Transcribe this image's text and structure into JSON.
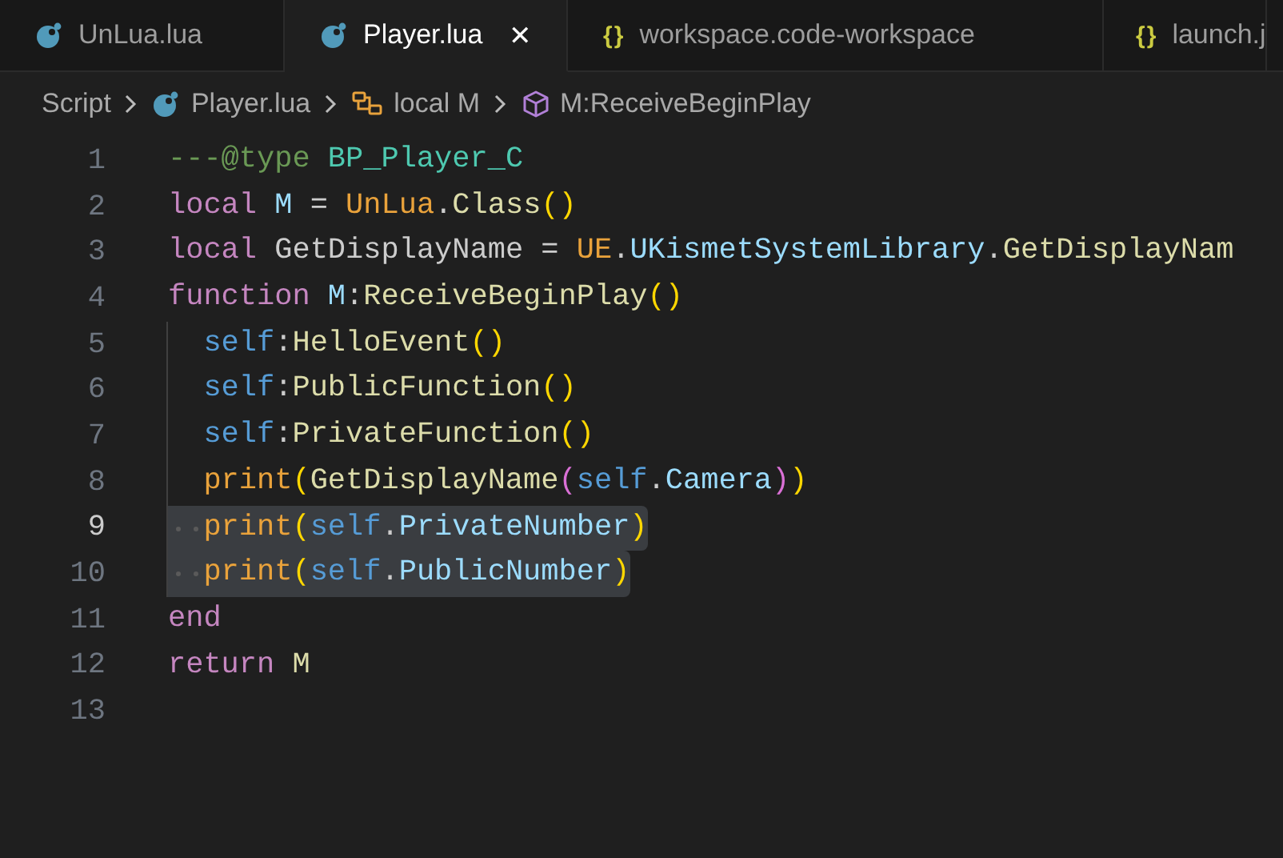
{
  "tabs": [
    {
      "label": "UnLua.lua",
      "kind": "lua",
      "selected": false
    },
    {
      "label": "Player.lua",
      "kind": "lua",
      "selected": true,
      "close": "✕"
    },
    {
      "label": "workspace.code-workspace",
      "kind": "json",
      "glyph": "{}",
      "selected": false
    },
    {
      "label": "launch.j",
      "kind": "json",
      "glyph": "{}",
      "selected": false
    }
  ],
  "breadcrumb": [
    {
      "label": "Script",
      "kind": "folder"
    },
    {
      "label": "Player.lua",
      "kind": "lua"
    },
    {
      "label": "local M",
      "kind": "variable"
    },
    {
      "label": "M:ReceiveBeginPlay",
      "kind": "method"
    }
  ],
  "lines": [
    {
      "number": "1",
      "active": false,
      "selected": false,
      "tokens": [
        {
          "t": "---@type ",
          "kind": "comment"
        },
        {
          "t": "BP_Player_C",
          "kind": "type"
        }
      ]
    },
    {
      "number": "2",
      "active": false,
      "selected": false,
      "tokens": [
        {
          "t": "local ",
          "kind": "keyword"
        },
        {
          "t": "M",
          "kind": "variable"
        },
        {
          "t": " = ",
          "kind": "plain"
        },
        {
          "t": "UnLua",
          "kind": "global"
        },
        {
          "t": ".",
          "kind": "plain"
        },
        {
          "t": "Class",
          "kind": "function"
        },
        {
          "t": "()",
          "kind": "paren"
        }
      ]
    },
    {
      "number": "3",
      "active": false,
      "selected": false,
      "tokens": [
        {
          "t": "local ",
          "kind": "keyword"
        },
        {
          "t": "GetDisplayName",
          "kind": "plain"
        },
        {
          "t": " = ",
          "kind": "plain"
        },
        {
          "t": "UE",
          "kind": "global"
        },
        {
          "t": ".",
          "kind": "plain"
        },
        {
          "t": "UKismetSystemLibrary",
          "kind": "property"
        },
        {
          "t": ".",
          "kind": "plain"
        },
        {
          "t": "GetDisplayNam",
          "kind": "function"
        }
      ]
    },
    {
      "number": "4",
      "active": false,
      "selected": false,
      "tokens": [
        {
          "t": "function ",
          "kind": "keyword"
        },
        {
          "t": "M",
          "kind": "variable"
        },
        {
          "t": ":",
          "kind": "plain"
        },
        {
          "t": "ReceiveBeginPlay",
          "kind": "function"
        },
        {
          "t": "()",
          "kind": "paren"
        }
      ]
    },
    {
      "number": "5",
      "kind": "indented",
      "active": false,
      "selected": false,
      "tokens": [
        {
          "t": "self",
          "kind": "self"
        },
        {
          "t": ":",
          "kind": "plain"
        },
        {
          "t": "HelloEvent",
          "kind": "function"
        },
        {
          "t": "()",
          "kind": "paren"
        }
      ]
    },
    {
      "number": "6",
      "kind": "indented",
      "active": false,
      "selected": false,
      "tokens": [
        {
          "t": "self",
          "kind": "self"
        },
        {
          "t": ":",
          "kind": "plain"
        },
        {
          "t": "PublicFunction",
          "kind": "function"
        },
        {
          "t": "()",
          "kind": "paren"
        }
      ]
    },
    {
      "number": "7",
      "kind": "indented",
      "active": false,
      "selected": false,
      "tokens": [
        {
          "t": "self",
          "kind": "self"
        },
        {
          "t": ":",
          "kind": "plain"
        },
        {
          "t": "PrivateFunction",
          "kind": "function"
        },
        {
          "t": "()",
          "kind": "paren"
        }
      ]
    },
    {
      "number": "8",
      "kind": "indented",
      "active": false,
      "selected": false,
      "tokens": [
        {
          "t": "print",
          "kind": "global"
        },
        {
          "t": "(",
          "kind": "paren"
        },
        {
          "t": "GetDisplayName",
          "kind": "function"
        },
        {
          "t": "(",
          "kind": "paren2"
        },
        {
          "t": "self",
          "kind": "self"
        },
        {
          "t": ".",
          "kind": "plain"
        },
        {
          "t": "Camera",
          "kind": "property"
        },
        {
          "t": ")",
          "kind": "paren2"
        },
        {
          "t": ")",
          "kind": "paren"
        }
      ]
    },
    {
      "number": "9",
      "kind": "indented",
      "active": true,
      "selected": true,
      "tokens": [
        {
          "t": "print",
          "kind": "global"
        },
        {
          "t": "(",
          "kind": "paren"
        },
        {
          "t": "self",
          "kind": "self"
        },
        {
          "t": ".",
          "kind": "plain"
        },
        {
          "t": "PrivateNumber",
          "kind": "property"
        },
        {
          "t": ")",
          "kind": "paren"
        }
      ]
    },
    {
      "number": "10",
      "kind": "indented",
      "active": false,
      "selected": true,
      "tokens": [
        {
          "t": "print",
          "kind": "global"
        },
        {
          "t": "(",
          "kind": "paren"
        },
        {
          "t": "self",
          "kind": "self"
        },
        {
          "t": ".",
          "kind": "plain"
        },
        {
          "t": "PublicNumber",
          "kind": "property"
        },
        {
          "t": ")",
          "kind": "paren"
        }
      ]
    },
    {
      "number": "11",
      "active": false,
      "selected": false,
      "tokens": [
        {
          "t": "end",
          "kind": "keyword"
        }
      ]
    },
    {
      "number": "12",
      "active": false,
      "selected": false,
      "tokens": [
        {
          "t": "return ",
          "kind": "keyword"
        },
        {
          "t": "M",
          "kind": "function"
        }
      ]
    },
    {
      "number": "13",
      "active": false,
      "selected": false
    }
  ]
}
